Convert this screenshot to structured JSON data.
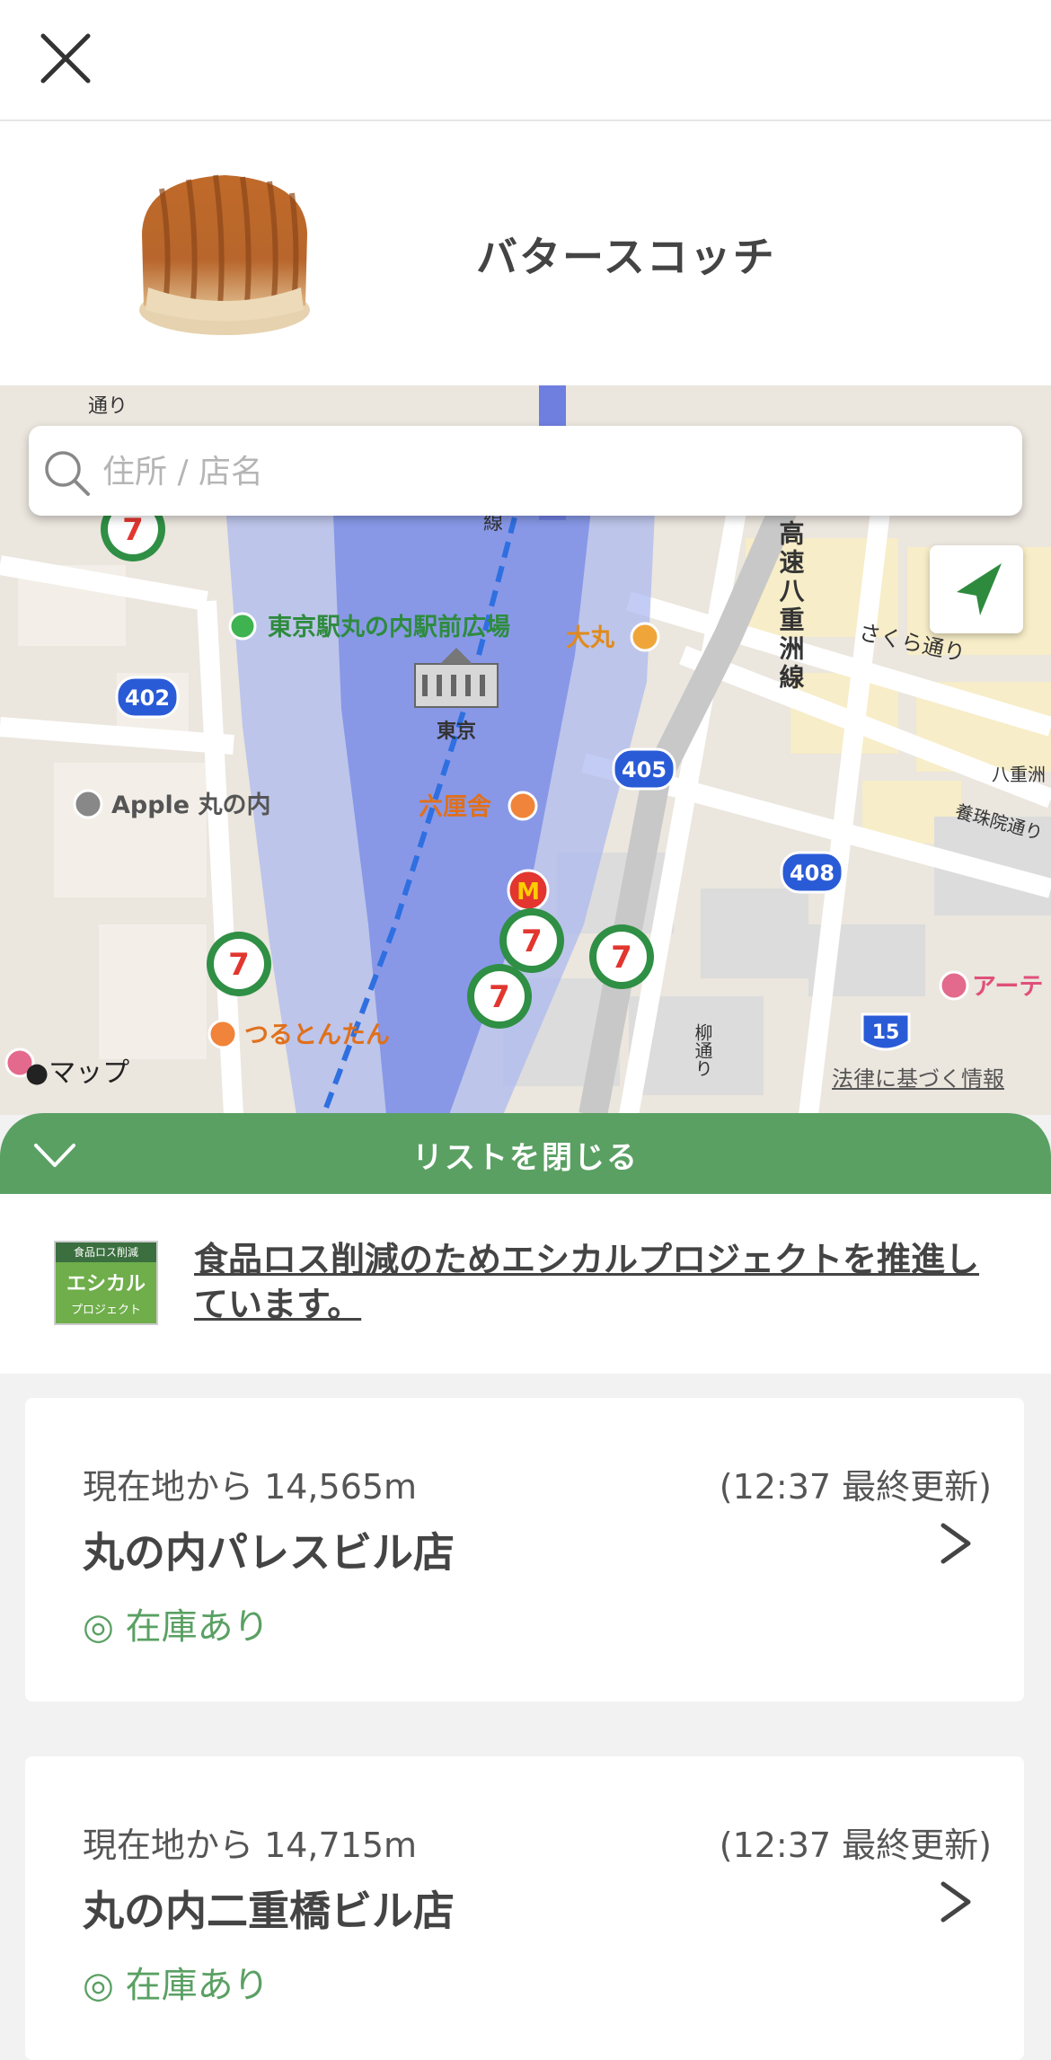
{
  "header": {
    "close_icon": "close-icon"
  },
  "product": {
    "name": "バタースコッチ",
    "image": "bread-image"
  },
  "map": {
    "search_placeholder": "住所 / 店名",
    "labels": {
      "plaza": "東京駅丸の内駅前広場",
      "daimaru": "大丸",
      "tokyo": "東京",
      "apple": "Apple 丸の内",
      "rokurinsha": "六厘舎",
      "tsurutontan": "つるとんたん",
      "route402": "402",
      "route405": "405",
      "route408": "408",
      "route15": "15",
      "sakura": "さくら通り",
      "expressway": "高速八重洲線",
      "yaesu": "八重洲",
      "yotsugi": "養珠院通り",
      "yanagi": "柳通り",
      "arte": "アーテ",
      "street_left": "通り",
      "line": "線"
    },
    "maps_attribution": "マップ",
    "legal_link": "法律に基づく情報"
  },
  "list_bar": {
    "label": "リストを閉じる"
  },
  "promo": {
    "logo_top": "食品ロス削減",
    "logo_mid": "エシカル",
    "logo_bot": "プロジェクト",
    "text": "食品ロス削減のためエシカルプロジェクトを推進しています。"
  },
  "stores": [
    {
      "distance": "現在地から 14,565m",
      "updated": "(12:37 最終更新)",
      "name": "丸の内パレスビル店",
      "stock": "◎ 在庫あり"
    },
    {
      "distance": "現在地から 14,715m",
      "updated": "(12:37 最終更新)",
      "name": "丸の内二重橋ビル店",
      "stock": "◎ 在庫あり"
    }
  ],
  "colors": {
    "accent": "#5aa063",
    "map_blue": "#7f8fe6"
  }
}
